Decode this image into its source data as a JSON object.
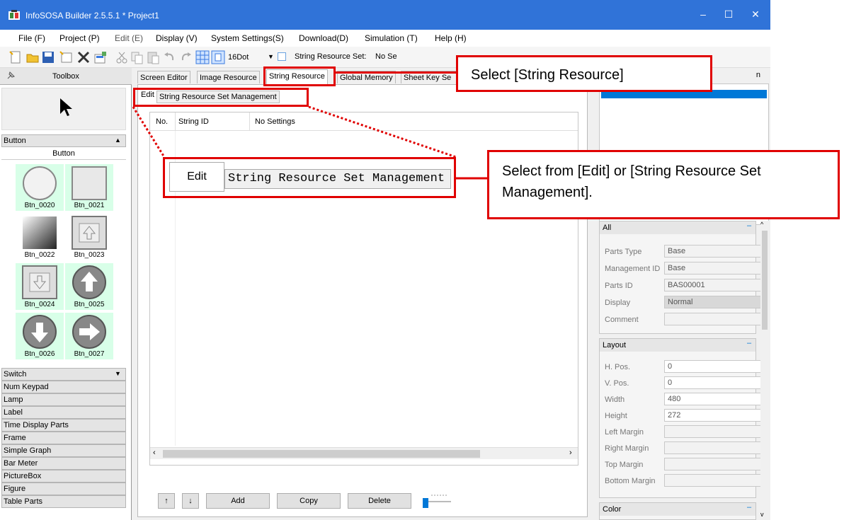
{
  "window": {
    "title": "InfoSOSA Builder 2.5.5.1 * Project1"
  },
  "menu": [
    {
      "label": "File (F)"
    },
    {
      "label": "Project (P)"
    },
    {
      "label": "Edit (E)"
    },
    {
      "label": "Display (V)"
    },
    {
      "label": "System Settings(S)"
    },
    {
      "label": "Download(D)"
    },
    {
      "label": "Simulation (T)"
    },
    {
      "label": "Help (H)"
    }
  ],
  "toolbar": {
    "dot": "16Dot",
    "resource_set_label": "String Resource Set:",
    "resource_set_value": "No Se"
  },
  "toolbox": {
    "title": "Toolbox",
    "button_section": "Button",
    "button_group": "Button",
    "buttons": [
      "Btn_0020",
      "Btn_0021",
      "Btn_0022",
      "Btn_0023",
      "Btn_0024",
      "Btn_0025",
      "Btn_0026",
      "Btn_0027"
    ],
    "sections": [
      "Switch",
      "Num Keypad",
      "Lamp",
      "Label",
      "Time Display Parts",
      "Frame",
      "Simple Graph",
      "Bar Meter",
      "PictureBox",
      "Figure",
      "Table Parts"
    ]
  },
  "tabs": [
    {
      "label": "Screen Editor"
    },
    {
      "label": "Image Resource"
    },
    {
      "label": "String Resource"
    },
    {
      "label": "Global Memory"
    },
    {
      "label": "Sheet Key Se"
    }
  ],
  "right_tab": "n",
  "subtabs": {
    "edit": "Edit",
    "manage": "String Resource Set Management"
  },
  "table": {
    "headers": [
      "No.",
      "String ID",
      "No Settings"
    ]
  },
  "buttons": {
    "up": "↑",
    "down": "↓",
    "add": "Add",
    "copy": "Copy",
    "delete": "Delete"
  },
  "properties": {
    "all": {
      "title": "All",
      "rows": [
        {
          "label": "Parts Type",
          "value": "Base"
        },
        {
          "label": "Management ID",
          "value": "Base"
        },
        {
          "label": "Parts ID",
          "value": "BAS00001"
        },
        {
          "label": "Display",
          "value": "Normal"
        },
        {
          "label": "Comment",
          "value": ""
        }
      ]
    },
    "layout": {
      "title": "Layout",
      "rows": [
        {
          "label": "H. Pos.",
          "value": "0"
        },
        {
          "label": "V. Pos.",
          "value": "0"
        },
        {
          "label": "Width",
          "value": "480"
        },
        {
          "label": "Height",
          "value": "272"
        },
        {
          "label": "Left Margin",
          "value": ""
        },
        {
          "label": "Right Margin",
          "value": ""
        },
        {
          "label": "Top Margin",
          "value": ""
        },
        {
          "label": "Bottom Margin",
          "value": ""
        }
      ]
    },
    "color": {
      "title": "Color"
    }
  },
  "callouts": {
    "select_string": "Select [String Resource]",
    "select_from": "Select from [Edit] or [String Resource Set Management]."
  },
  "colors": {
    "titlebar": "#3073d8",
    "highlight": "#e00000",
    "selection": "#0078d7"
  }
}
